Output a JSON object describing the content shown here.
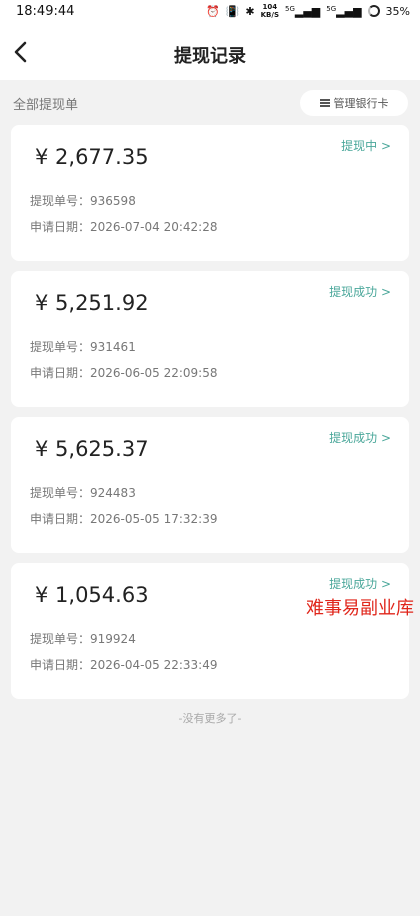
{
  "status_bar": {
    "time": "18:49:44",
    "net_speed_top": "104",
    "net_speed_bottom": "KB/S",
    "signal_1": "5G",
    "signal_2": "5G",
    "battery": "35%"
  },
  "nav": {
    "title": "提现记录"
  },
  "filter": {
    "label": "全部提现单",
    "bank_button": "管理银行卡"
  },
  "records": [
    {
      "amount": "¥ 2,677.35",
      "status": "提现中 >",
      "id_label": "提现单号：",
      "id": "936598",
      "date_label": "申请日期：",
      "date": "2026-07-04 20:42:28"
    },
    {
      "amount": "¥ 5,251.92",
      "status": "提现成功 >",
      "id_label": "提现单号：",
      "id": "931461",
      "date_label": "申请日期：",
      "date": "2026-06-05 22:09:58"
    },
    {
      "amount": "¥ 5,625.37",
      "status": "提现成功 >",
      "id_label": "提现单号：",
      "id": "924483",
      "date_label": "申请日期：",
      "date": "2026-05-05 17:32:39"
    },
    {
      "amount": "¥ 1,054.63",
      "status": "提现成功 >",
      "id_label": "提现单号：",
      "id": "919924",
      "date_label": "申请日期：",
      "date": "2026-04-05 22:33:49"
    }
  ],
  "watermark": "难事易副业库",
  "end_text": "-没有更多了-",
  "colors": {
    "accent": "#4aa79a",
    "watermark": "#e0261b"
  }
}
